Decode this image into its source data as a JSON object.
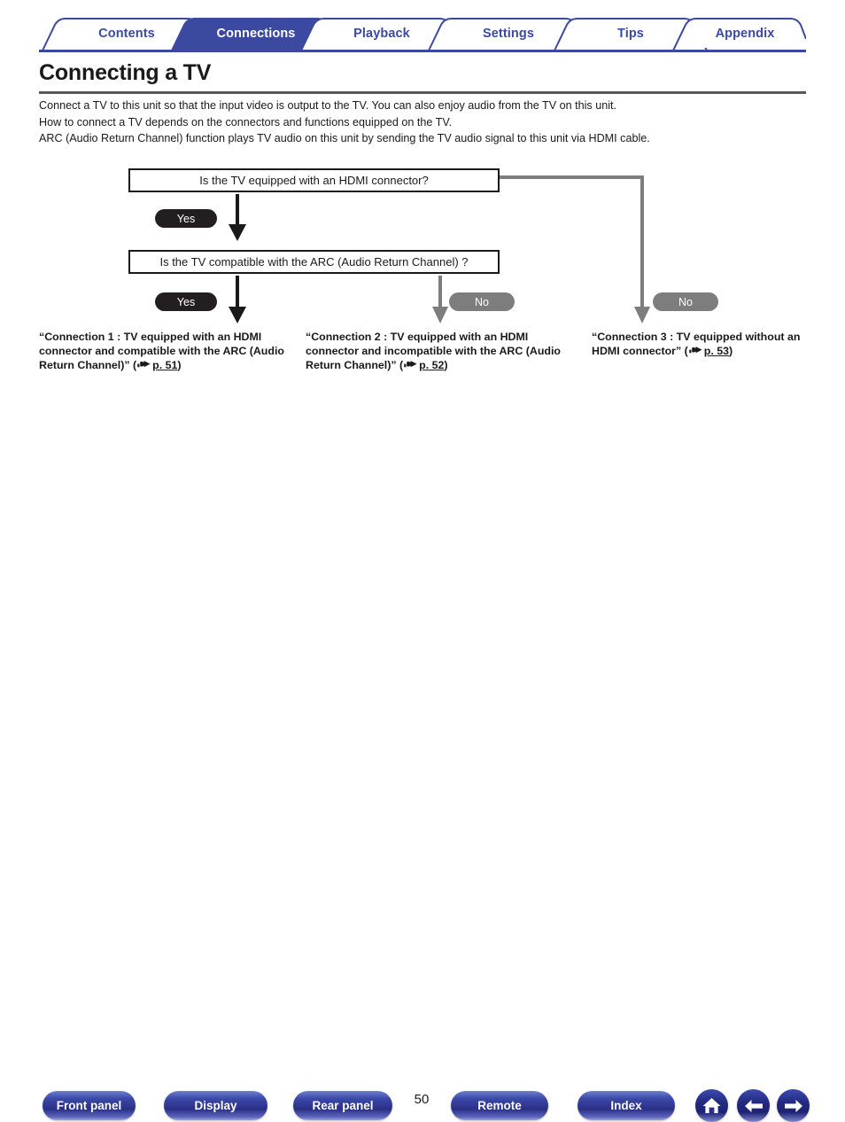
{
  "tabs": [
    {
      "label": "Contents",
      "active": false
    },
    {
      "label": "Connections",
      "active": true
    },
    {
      "label": "Playback",
      "active": false
    },
    {
      "label": "Settings",
      "active": false
    },
    {
      "label": "Tips",
      "active": false
    },
    {
      "label": "Appendix",
      "active": false
    }
  ],
  "page": {
    "title": "Connecting a TV",
    "number": "50",
    "intro": [
      "Connect a TV to this unit so that the input video is output to the TV. You can also enjoy audio from the TV on this unit.",
      "How to connect a TV depends on the connectors and functions equipped on the TV.",
      "ARC (Audio Return Channel) function plays TV audio on this unit by sending the TV audio signal to this unit via HDMI cable."
    ]
  },
  "flowchart": {
    "question1": "Is the TV equipped with an HDMI connector?",
    "question2": "Is the TV compatible with the ARC (Audio Return Channel) ?",
    "badge_yes_1": "Yes",
    "badge_yes_2": "Yes",
    "badge_no_1": "No",
    "badge_no_2": "No",
    "results": [
      {
        "text": "“Connection 1 : TV equipped with an HDMI connector and compatible with the ARC (Audio Return Channel)” (",
        "page": "p. 51",
        "tail": ")"
      },
      {
        "text": "“Connection 2 : TV equipped with an HDMI connector and incompatible with the ARC (Audio Return Channel)” (",
        "page": "p. 52",
        "tail": ")"
      },
      {
        "text": "“Connection 3 : TV equipped without an HDMI connector” (",
        "page": "p. 53",
        "tail": ")"
      }
    ]
  },
  "footer": {
    "buttons": [
      {
        "label": "Front panel"
      },
      {
        "label": "Display"
      },
      {
        "label": "Rear panel"
      },
      {
        "label": "Remote"
      },
      {
        "label": "Index"
      }
    ],
    "icons": [
      {
        "name": "home-icon"
      },
      {
        "name": "arrow-left-icon"
      },
      {
        "name": "arrow-right-icon"
      }
    ]
  },
  "colors": {
    "brand_blue": "#3b49a0",
    "tab_active_bg": "#3b49a0",
    "yes_badge": "#231f20",
    "no_badge": "#7d7d7d",
    "connector_gray": "#7d7d7d",
    "rule_gray": "#595959"
  }
}
